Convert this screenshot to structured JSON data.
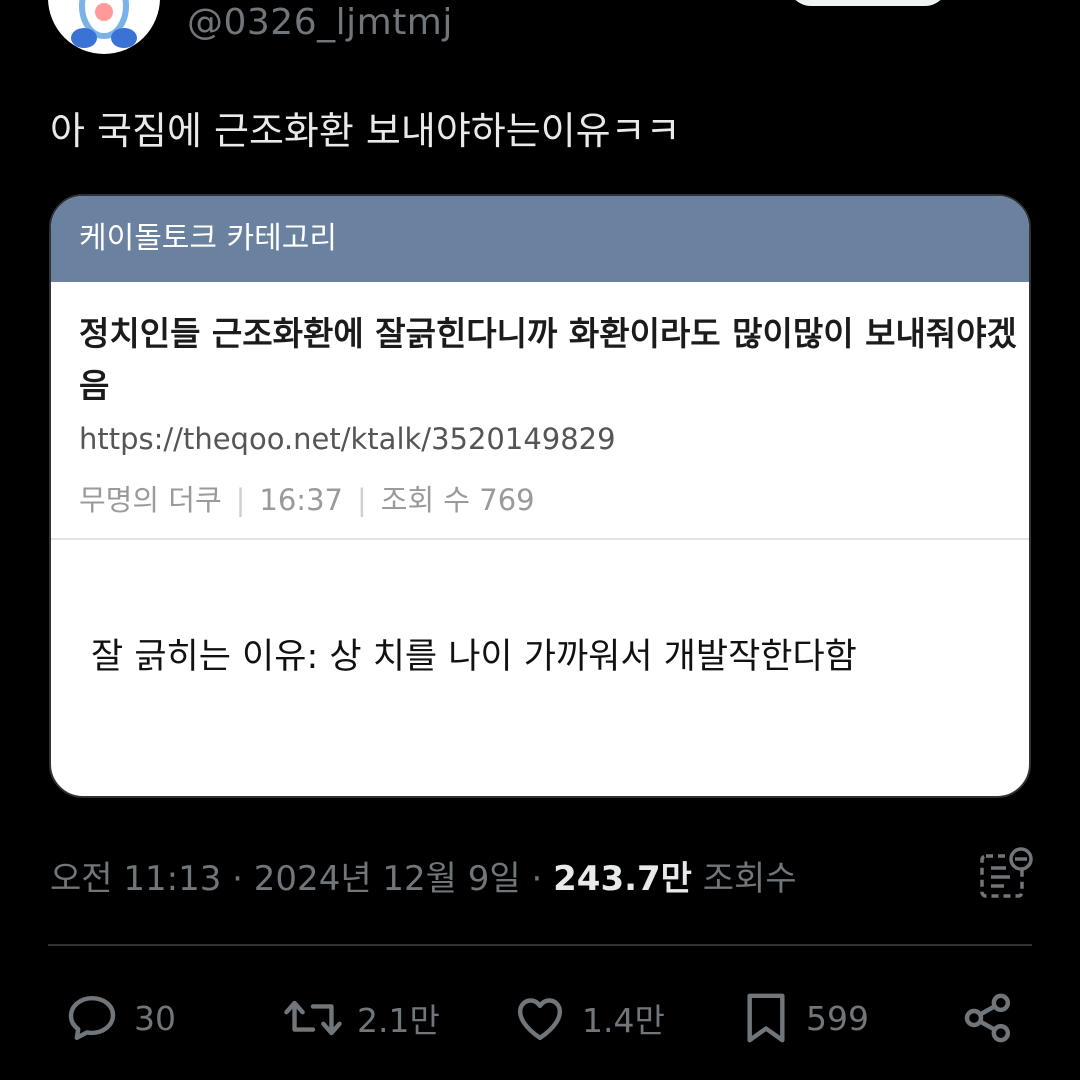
{
  "user": {
    "handle": "@0326_ljmtmj"
  },
  "tweet": {
    "text": "아 국짐에 근조화환 보내야하는이유ㅋㅋ"
  },
  "card": {
    "category": "케이돌토크 카테고리",
    "title": "정치인들 근조화환에 잘긁힌다니까 화환이라도 많이많이 보내줘야겠음",
    "url": "https://theqoo.net/ktalk/3520149829",
    "author": "무명의 더쿠",
    "time": "16:37",
    "views": "조회 수 769",
    "body": "잘 긁히는 이유: 상 치를 나이 가까워서 개발작한다함"
  },
  "meta": {
    "time": "오전 11:13",
    "date": "2024년 12월 9일",
    "views_count": "243.7만",
    "views_label": "조회수"
  },
  "actions": {
    "reply": "30",
    "retweet": "2.1만",
    "like": "1.4만",
    "bookmark": "599"
  },
  "colors": {
    "background": "#000000",
    "card_header": "#6a829f",
    "muted": "#71767b"
  }
}
